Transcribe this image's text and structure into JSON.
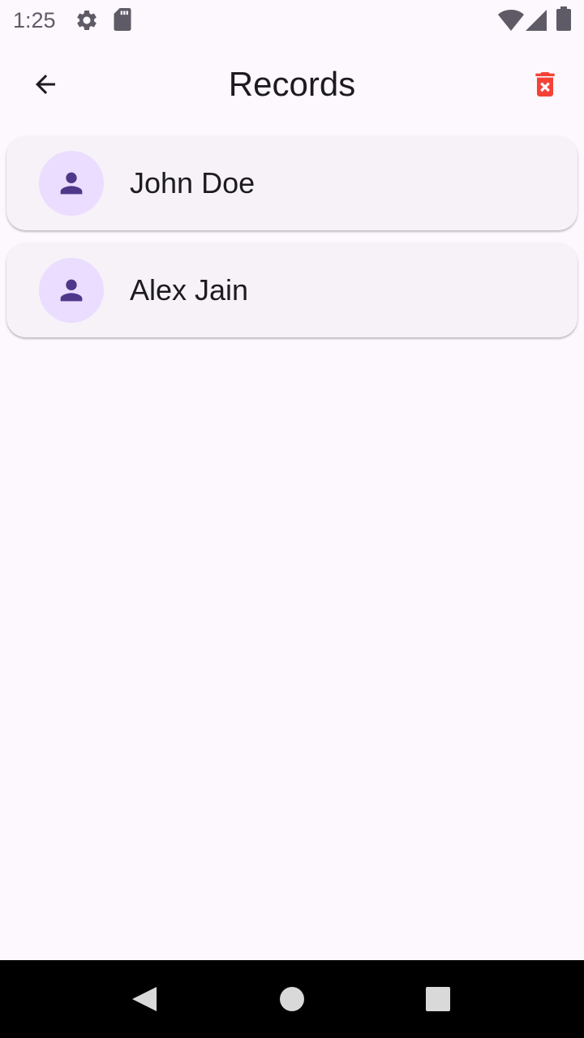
{
  "status_bar": {
    "time": "1:25",
    "icons": [
      "settings-icon",
      "sd-card-icon",
      "wifi-icon",
      "signal-icon",
      "battery-icon"
    ]
  },
  "app_bar": {
    "title": "Records",
    "back_icon": "arrow-back-icon",
    "delete_icon": "delete-forever-icon"
  },
  "records": [
    {
      "name": "John Doe",
      "icon": "person-icon"
    },
    {
      "name": "Alex Jain",
      "icon": "person-icon"
    }
  ],
  "nav_bar": {
    "buttons": [
      "back-triangle-icon",
      "home-circle-icon",
      "recents-square-icon"
    ]
  },
  "colors": {
    "background": "#fdf7fe",
    "card": "#f6f2f8",
    "avatar_bg": "#eaddff",
    "avatar_icon": "#4f378a",
    "delete": "#f44336",
    "nav_bar": "#000000"
  }
}
